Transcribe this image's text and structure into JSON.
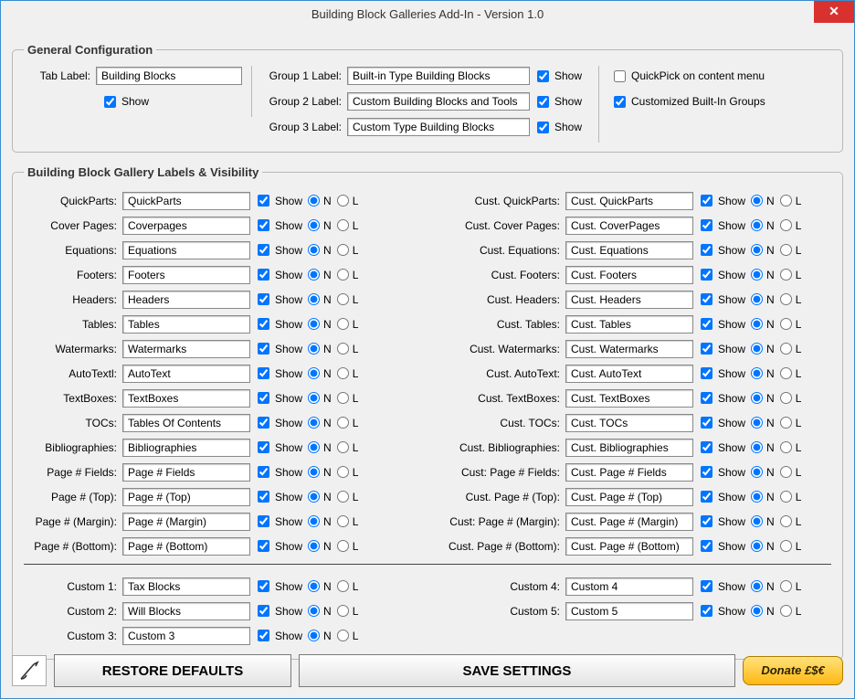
{
  "window": {
    "title": "Building Block Galleries Add-In - Version 1.0",
    "close": "✕"
  },
  "general": {
    "legend": "General Configuration",
    "tab_label_lbl": "Tab Label:",
    "tab_label_value": "Building Blocks",
    "tab_show_label": "Show",
    "group1_lbl": "Group 1 Label:",
    "group1_value": "Built-in Type Building Blocks",
    "group2_lbl": "Group 2 Label:",
    "group2_value": "Custom Building Blocks and Tools",
    "group3_lbl": "Group 3 Label:",
    "group3_value": "Custom Type Building Blocks",
    "show_lbl": "Show",
    "quickpick_lbl": "QuickPick on content menu",
    "customized_lbl": "Customized Built-In Groups"
  },
  "gallery": {
    "legend": "Building Block Gallery Labels & Visibility",
    "show_lbl": "Show",
    "n_lbl": "N",
    "l_lbl": "L",
    "left": [
      {
        "lbl": "QuickParts:",
        "val": "QuickParts"
      },
      {
        "lbl": "Cover Pages:",
        "val": "Coverpages"
      },
      {
        "lbl": "Equations:",
        "val": "Equations"
      },
      {
        "lbl": "Footers:",
        "val": "Footers"
      },
      {
        "lbl": "Headers:",
        "val": "Headers"
      },
      {
        "lbl": "Tables:",
        "val": "Tables"
      },
      {
        "lbl": "Watermarks:",
        "val": "Watermarks"
      },
      {
        "lbl": "AutoTextl:",
        "val": "AutoText"
      },
      {
        "lbl": "TextBoxes:",
        "val": "TextBoxes"
      },
      {
        "lbl": "TOCs:",
        "val": "Tables Of Contents"
      },
      {
        "lbl": "Bibliographies:",
        "val": "Bibliographies"
      },
      {
        "lbl": "Page # Fields:",
        "val": "Page # Fields"
      },
      {
        "lbl": "Page # (Top):",
        "val": "Page # (Top)"
      },
      {
        "lbl": "Page # (Margin):",
        "val": "Page # (Margin)"
      },
      {
        "lbl": "Page # (Bottom):",
        "val": "Page # (Bottom)"
      }
    ],
    "right": [
      {
        "lbl": "Cust. QuickParts:",
        "val": "Cust. QuickParts"
      },
      {
        "lbl": "Cust. Cover Pages:",
        "val": "Cust. CoverPages"
      },
      {
        "lbl": "Cust. Equations:",
        "val": "Cust. Equations"
      },
      {
        "lbl": "Cust. Footers:",
        "val": "Cust. Footers"
      },
      {
        "lbl": "Cust. Headers:",
        "val": "Cust. Headers"
      },
      {
        "lbl": "Cust. Tables:",
        "val": "Cust. Tables"
      },
      {
        "lbl": "Cust. Watermarks:",
        "val": "Cust. Watermarks"
      },
      {
        "lbl": "Cust. AutoText:",
        "val": "Cust. AutoText"
      },
      {
        "lbl": "Cust. TextBoxes:",
        "val": "Cust. TextBoxes"
      },
      {
        "lbl": "Cust. TOCs:",
        "val": "Cust. TOCs"
      },
      {
        "lbl": "Cust. Bibliographies:",
        "val": "Cust. Bibliographies"
      },
      {
        "lbl": "Cust: Page # Fields:",
        "val": "Cust. Page # Fields"
      },
      {
        "lbl": "Cust. Page # (Top):",
        "val": "Cust. Page # (Top)"
      },
      {
        "lbl": "Cust: Page # (Margin):",
        "val": "Cust. Page # (Margin)"
      },
      {
        "lbl": "Cust. Page # (Bottom):",
        "val": "Cust. Page # (Bottom)"
      }
    ],
    "cleft": [
      {
        "lbl": "Custom 1:",
        "val": "Tax Blocks"
      },
      {
        "lbl": "Custom 2:",
        "val": "Will Blocks"
      },
      {
        "lbl": "Custom 3:",
        "val": "Custom 3"
      }
    ],
    "cright": [
      {
        "lbl": "Custom 4:",
        "val": "Custom 4"
      },
      {
        "lbl": "Custom 5:",
        "val": "Custom 5"
      }
    ]
  },
  "buttons": {
    "restore": "RESTORE DEFAULTS",
    "save": "SAVE SETTINGS",
    "donate": "Donate £$€"
  }
}
